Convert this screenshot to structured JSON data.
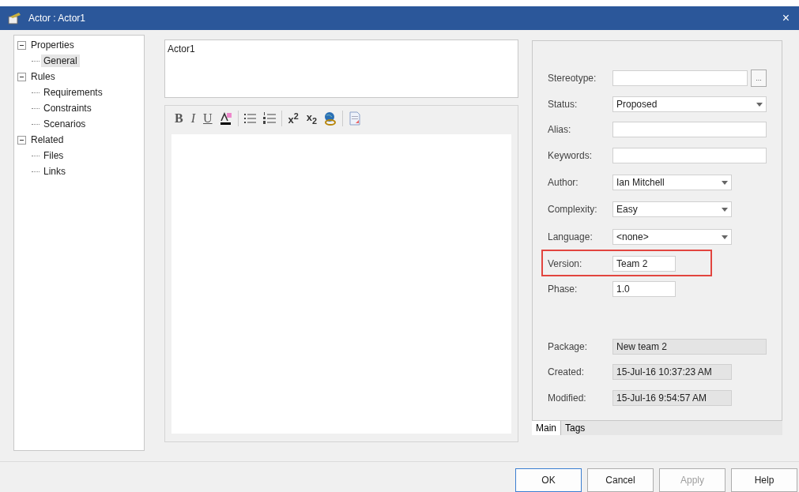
{
  "window": {
    "title": "Actor : Actor1",
    "close": "×"
  },
  "tree": [
    {
      "label": "Properties",
      "expanded": true,
      "selected": false,
      "children": [
        {
          "label": "General",
          "selected": true
        }
      ]
    },
    {
      "label": "Rules",
      "expanded": true,
      "selected": false,
      "children": [
        {
          "label": "Requirements",
          "selected": false
        },
        {
          "label": "Constraints",
          "selected": false
        },
        {
          "label": "Scenarios",
          "selected": false
        }
      ]
    },
    {
      "label": "Related",
      "expanded": true,
      "selected": false,
      "children": [
        {
          "label": "Files",
          "selected": false
        },
        {
          "label": "Links",
          "selected": false
        }
      ]
    }
  ],
  "name_field": {
    "value": "Actor1"
  },
  "toolbar": [
    {
      "kind": "bold",
      "label": "B"
    },
    {
      "kind": "italic",
      "label": "I"
    },
    {
      "kind": "underline",
      "label": "U"
    },
    {
      "kind": "color"
    },
    {
      "kind": "separator"
    },
    {
      "kind": "bullets"
    },
    {
      "kind": "numbers"
    },
    {
      "kind": "separator"
    },
    {
      "kind": "superscript",
      "label": "x$^{2}$"
    },
    {
      "kind": "subscript",
      "label": "x$_{2}$"
    },
    {
      "kind": "globe"
    },
    {
      "kind": "separator"
    },
    {
      "kind": "document"
    }
  ],
  "fields": [
    {
      "label": "Stereotype:",
      "kind": "browse",
      "browse_label": "...",
      "highlighted": false
    },
    {
      "label": "Status:",
      "kind": "combo",
      "value": "Proposed",
      "highlighted": false
    },
    {
      "label": "Alias:",
      "kind": "text",
      "highlighted": false
    },
    {
      "label": "Keywords:",
      "kind": "text",
      "highlighted": false
    },
    {
      "label": "Author:",
      "kind": "combo",
      "value": "Ian Mitchell",
      "highlighted": false
    },
    {
      "label": "Complexity:",
      "kind": "combo",
      "value": "Easy",
      "highlighted": false
    },
    {
      "label": "Language:",
      "kind": "combo",
      "value": "<none>",
      "highlighted": false
    },
    {
      "label": "Version:",
      "kind": "text",
      "value": "Team 2",
      "highlighted": true
    },
    {
      "label": "Phase:",
      "kind": "text",
      "value": "1.0",
      "highlighted": false
    },
    {
      "label": "Package:",
      "kind": "readonly",
      "value": "New team 2",
      "highlighted": false
    },
    {
      "label": "Created:",
      "kind": "readonly",
      "value": "15-Jul-16 10:37:23 AM",
      "highlighted": false
    },
    {
      "label": "Modified:",
      "kind": "readonly",
      "value": "15-Jul-16 9:54:57 AM",
      "highlighted": false
    }
  ],
  "tabs": [
    {
      "label": "Main",
      "selected": true
    },
    {
      "label": "Tags",
      "selected": false
    }
  ],
  "buttons": [
    {
      "label": "OK",
      "default": true,
      "disabled": false
    },
    {
      "label": "Cancel",
      "default": false,
      "disabled": false
    },
    {
      "label": "Apply",
      "default": false,
      "disabled": true
    },
    {
      "label": "Help",
      "default": false,
      "disabled": false
    }
  ]
}
